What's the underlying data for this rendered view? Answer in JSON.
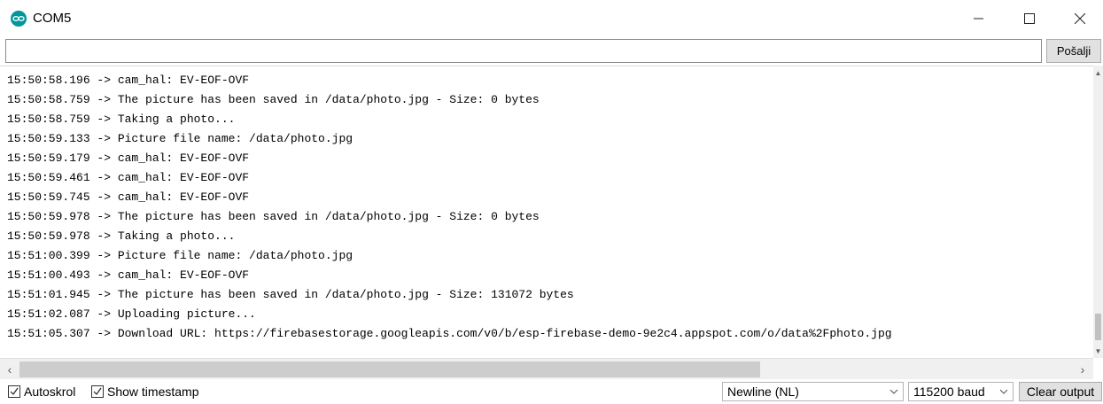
{
  "window": {
    "title": "COM5",
    "icon": "arduino-logo-icon"
  },
  "send": {
    "input_value": "",
    "button_label": "Pošalji"
  },
  "log_lines": [
    "15:50:58.196 -> cam_hal: EV-EOF-OVF",
    "15:50:58.759 -> The picture has been saved in /data/photo.jpg - Size: 0 bytes",
    "15:50:58.759 -> Taking a photo...",
    "15:50:59.133 -> Picture file name: /data/photo.jpg",
    "15:50:59.179 -> cam_hal: EV-EOF-OVF",
    "15:50:59.461 -> cam_hal: EV-EOF-OVF",
    "15:50:59.745 -> cam_hal: EV-EOF-OVF",
    "15:50:59.978 -> The picture has been saved in /data/photo.jpg - Size: 0 bytes",
    "15:50:59.978 -> Taking a photo...",
    "15:51:00.399 -> Picture file name: /data/photo.jpg",
    "15:51:00.493 -> cam_hal: EV-EOF-OVF",
    "15:51:01.945 -> The picture has been saved in /data/photo.jpg - Size: 131072 bytes",
    "15:51:02.087 -> Uploading picture...",
    "15:51:05.307 -> Download URL: https://firebasestorage.googleapis.com/v0/b/esp-firebase-demo-9e2c4.appspot.com/o/data%2Fphoto.jpg"
  ],
  "footer": {
    "autoscroll_label": "Autoskrol",
    "autoscroll_checked": true,
    "timestamp_label": "Show timestamp",
    "timestamp_checked": true,
    "line_ending": "Newline (NL)",
    "baud_rate": "115200 baud",
    "clear_label": "Clear output"
  }
}
